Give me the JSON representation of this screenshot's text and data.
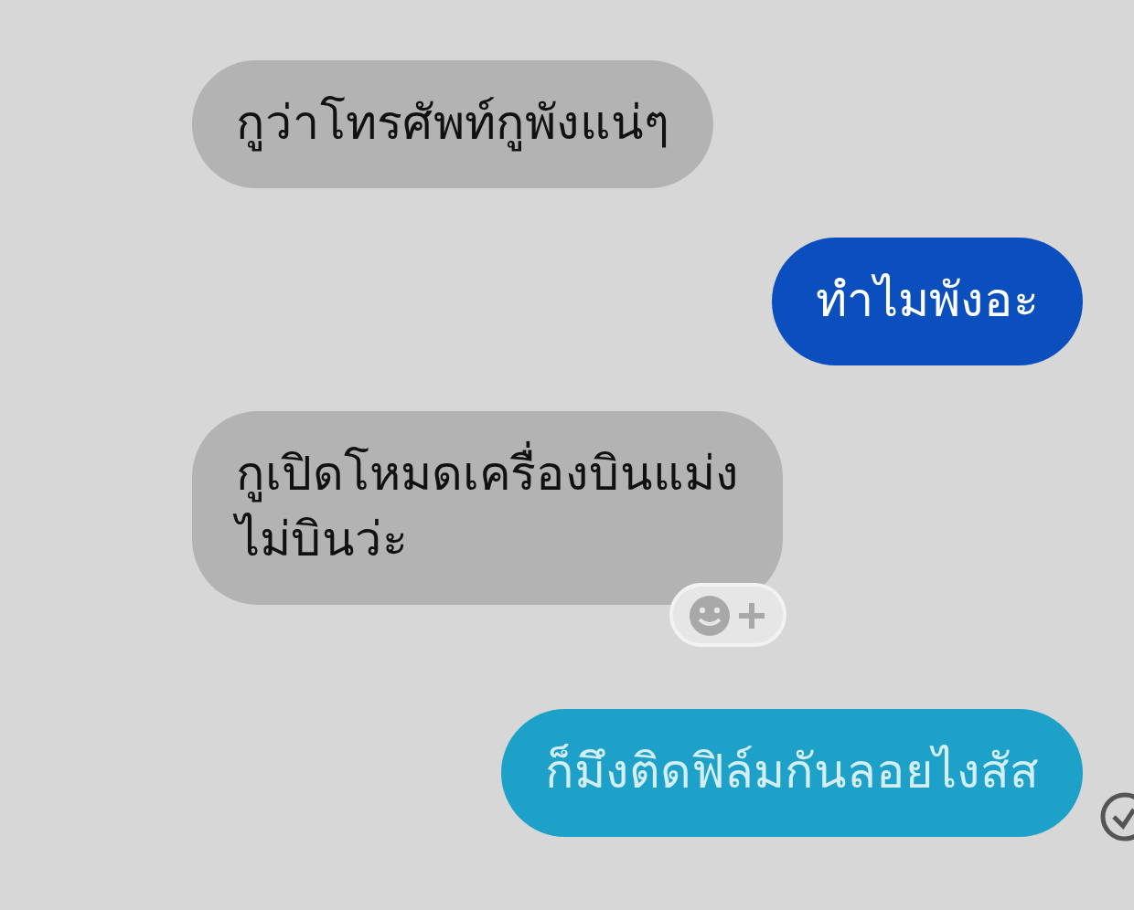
{
  "messages": [
    {
      "kind": "received",
      "text": "กูว่าโทรศัพท์กูพังแน่ๆ",
      "reaction_button": false,
      "read_receipt": false
    },
    {
      "kind": "sent",
      "text": "ทำไมพังอะ",
      "color": "#0b4fbf",
      "reaction_button": false,
      "read_receipt": false
    },
    {
      "kind": "received",
      "text": "กูเปิดโหมดเครื่องบินแม่ง\nไม่บินว่ะ",
      "reaction_button": true,
      "read_receipt": false
    },
    {
      "kind": "sent",
      "text": "ก็มึงติดฟิล์มกันลอยไงสัส",
      "color": "#1da1c8",
      "reaction_button": false,
      "read_receipt": true
    }
  ]
}
